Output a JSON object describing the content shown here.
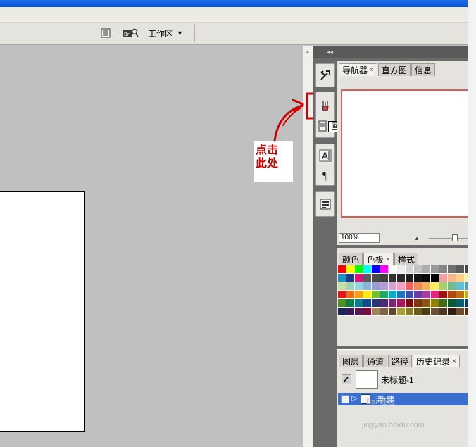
{
  "options_bar": {
    "workspace_label": "工作区"
  },
  "annotation": {
    "line1": "点击",
    "line2": "此处"
  },
  "dock": {
    "tooltip": "画笔",
    "buttons": [
      "tools-icon",
      "brush-icon",
      "clone-source-icon",
      "character-icon",
      "paragraph-icon",
      "layer-comps-icon"
    ]
  },
  "navigator_panel": {
    "tabs": [
      {
        "label": "导航器",
        "close": "×",
        "active": true
      },
      {
        "label": "直方图",
        "active": false
      },
      {
        "label": "信息",
        "active": false
      }
    ],
    "zoom_value": "100%"
  },
  "swatches_panel": {
    "tabs": [
      {
        "label": "颜色",
        "active": false
      },
      {
        "label": "色板",
        "close": "×",
        "active": true
      },
      {
        "label": "样式",
        "active": false
      }
    ],
    "colors": [
      "#ff0000",
      "#ffff00",
      "#00ff00",
      "#00ffff",
      "#0000ff",
      "#ff00ff",
      "#ffffff",
      "#ebebeb",
      "#d6d6d6",
      "#c2c2c2",
      "#adadad",
      "#999999",
      "#858585",
      "#707070",
      "#5c5c5c",
      "#474747",
      "#1e90c8",
      "#1c3c8c",
      "#e0107c",
      "#5a5a5a",
      "#4a4a4a",
      "#3d3d3d",
      "#333333",
      "#292929",
      "#1f1f1f",
      "#141414",
      "#0a0a0a",
      "#000000",
      "#f4a0a0",
      "#f8b88c",
      "#fcd088",
      "#fff09c",
      "#c4e0a0",
      "#9cd4b4",
      "#94d4e4",
      "#8cb4e0",
      "#9c9cd4",
      "#b49cd4",
      "#dca0d0",
      "#f4a0c0",
      "#ec6464",
      "#f08c54",
      "#f8b050",
      "#fff060",
      "#a4d070",
      "#6cc08c",
      "#60c0d8",
      "#5c94d0",
      "#e01818",
      "#ec6a1c",
      "#f8a018",
      "#fcec14",
      "#74c030",
      "#20a864",
      "#10a8c8",
      "#2074c0",
      "#3c50a8",
      "#6c3ca4",
      "#a83c98",
      "#e02878",
      "#a41010",
      "#b04810",
      "#b87010",
      "#c0b010",
      "#509020",
      "#107c48",
      "#0c7c94",
      "#104c8c",
      "#283478",
      "#4c2878",
      "#7c2470",
      "#a81858",
      "#780c0c",
      "#803410",
      "#8c5410",
      "#908008",
      "#3c6c14",
      "#085c34",
      "#085c70",
      "#08386c",
      "#1c2458",
      "#381c58",
      "#5c1850",
      "#7c0c40",
      "#a0845c",
      "#846448",
      "#604430",
      "#a8a040",
      "#887c30",
      "#685c20",
      "#484010",
      "#6c5034",
      "#4c3824",
      "#302014",
      "#6c4c2c",
      "#503018"
    ]
  },
  "history_panel": {
    "tabs": [
      {
        "label": "图层",
        "active": false
      },
      {
        "label": "通道",
        "active": false
      },
      {
        "label": "路径",
        "active": false
      },
      {
        "label": "历史记录",
        "close": "×",
        "active": true
      }
    ],
    "snapshot_label": "未标题-1",
    "step_label": "新建"
  },
  "watermark": {
    "line1": "Bai 经验",
    "line2": "jingyan.baidu.com"
  }
}
